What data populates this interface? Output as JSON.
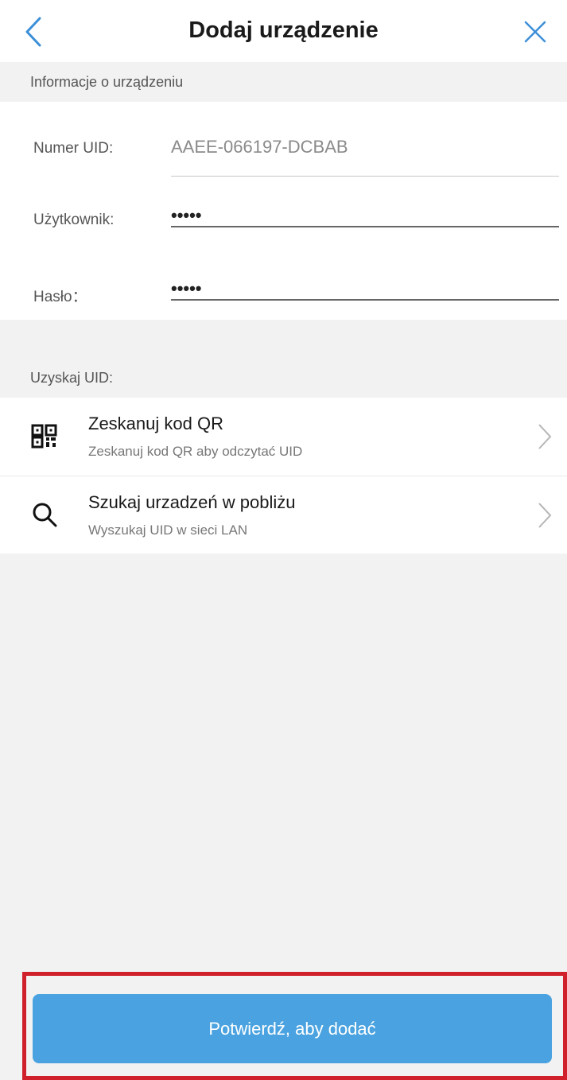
{
  "header": {
    "title": "Dodaj urządzenie",
    "back_icon": "chevron-left-icon",
    "close_icon": "close-icon"
  },
  "device_info": {
    "section_label": "Informacje o urządzeniu",
    "uid": {
      "label": "Numer UID:",
      "placeholder": "AAEE-066197-DCBAB"
    },
    "user": {
      "label": "Użytkownik:",
      "value": "•••••"
    },
    "password": {
      "label": "Hasło：",
      "value": "•••••"
    }
  },
  "get_uid": {
    "section_label": "Uzyskaj UID:",
    "items": [
      {
        "icon": "qr-code-icon",
        "title": "Zeskanuj kod QR",
        "subtitle": "Zeskanuj kod QR aby odczytać UID"
      },
      {
        "icon": "search-icon",
        "title": "Szukaj urzadzeń w pobliżu",
        "subtitle": "Wyszukaj UID w sieci LAN"
      }
    ]
  },
  "confirm": {
    "label": "Potwierdź, aby dodać"
  },
  "colors": {
    "accent": "#4aa3e0",
    "highlight_border": "#d0202c",
    "background": "#f2f2f2"
  }
}
